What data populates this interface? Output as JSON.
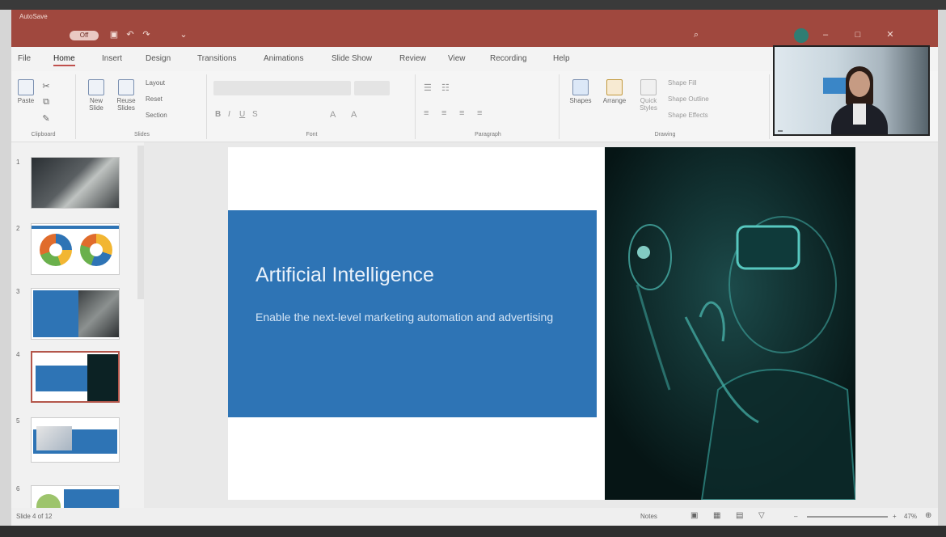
{
  "titlebar": {
    "app_label": "AutoSave",
    "toggle_label": "Off",
    "document_title": "",
    "user_label": ""
  },
  "menu": {
    "tabs": [
      "File",
      "Home",
      "Insert",
      "Design",
      "Transitions",
      "Animations",
      "Slide Show",
      "Review",
      "View",
      "Recording",
      "Help"
    ],
    "active": "Home"
  },
  "ribbon": {
    "clipboard": {
      "paste": "Paste",
      "group": "Clipboard"
    },
    "slides": {
      "new_slide": "New Slide",
      "reuse": "Reuse Slides",
      "layout": "Layout",
      "reset": "Reset",
      "section": "Section",
      "group": "Slides"
    },
    "font": {
      "group": "Font"
    },
    "paragraph": {
      "group": "Paragraph"
    },
    "drawing": {
      "shapes": "Shapes",
      "arrange": "Arrange",
      "quick_styles": "Quick Styles",
      "shape_fill": "Shape Fill",
      "shape_outline": "Shape Outline",
      "shape_effects": "Shape Effects",
      "group": "Drawing"
    }
  },
  "video": {
    "name_tag": "",
    "sign_text": ""
  },
  "thumbnails": [
    {
      "num": "1"
    },
    {
      "num": "2"
    },
    {
      "num": "3"
    },
    {
      "num": "4"
    },
    {
      "num": "5"
    },
    {
      "num": "6"
    }
  ],
  "slide": {
    "title": "Artificial Intelligence",
    "subtitle": "Enable the next-level marketing automation and advertising",
    "footnote": ""
  },
  "status": {
    "slide_info": "Slide 4 of 12",
    "notes": "Notes",
    "zoom": "47%"
  },
  "colors": {
    "titlebar": "#a0483e",
    "slide_blue": "#2e74b5",
    "selection": "#b4574b"
  }
}
